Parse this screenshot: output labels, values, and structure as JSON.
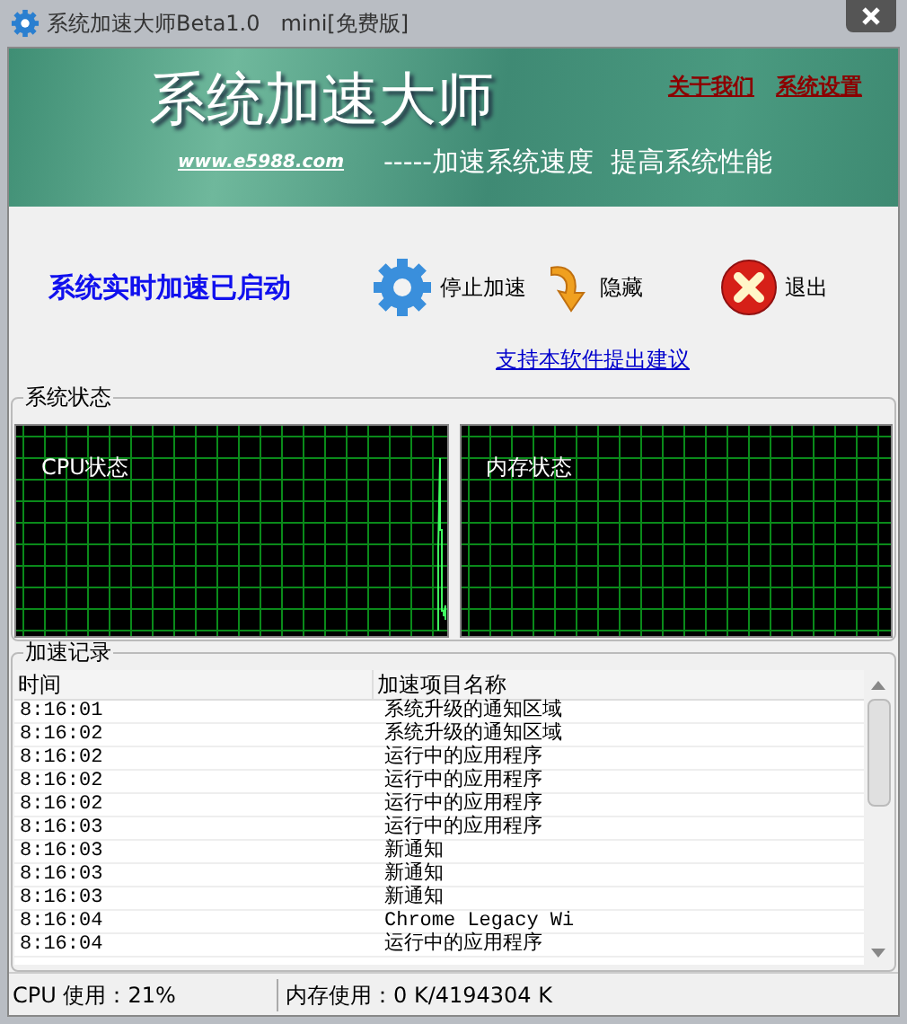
{
  "window": {
    "title": "系统加速大师Beta1.0   mini[免费版]"
  },
  "banner": {
    "title": "系统加速大师",
    "links": [
      "关于我们",
      "系统设置"
    ],
    "site": "www.e5988.com",
    "slogan": "-----加速系统速度  提高系统性能"
  },
  "status_message": "系统实时加速已启动",
  "actions": [
    {
      "kind": "gear",
      "label": "停止加速"
    },
    {
      "kind": "arrow",
      "label": "隐藏"
    },
    {
      "kind": "close",
      "label": "退出"
    }
  ],
  "feedback_link": "支持本软件提出建议",
  "system_status": {
    "title": "系统状态",
    "monitors": [
      {
        "label": "CPU状态",
        "kind": "cpu"
      },
      {
        "label": "内存状态",
        "kind": "memory"
      }
    ]
  },
  "log": {
    "title": "加速记录",
    "columns": [
      "时间",
      "加速项目名称"
    ],
    "rows": [
      {
        "time": "8:16:01",
        "item": "系统升级的通知区域"
      },
      {
        "time": "8:16:02",
        "item": "系统升级的通知区域"
      },
      {
        "time": "8:16:02",
        "item": "运行中的应用程序"
      },
      {
        "time": "8:16:02",
        "item": "运行中的应用程序"
      },
      {
        "time": "8:16:02",
        "item": "运行中的应用程序"
      },
      {
        "time": "8:16:03",
        "item": "运行中的应用程序"
      },
      {
        "time": "8:16:03",
        "item": "新通知"
      },
      {
        "time": "8:16:03",
        "item": "新通知"
      },
      {
        "time": "8:16:03",
        "item": "新通知"
      },
      {
        "time": "8:16:04",
        "item": "Chrome Legacy Wi"
      },
      {
        "time": "8:16:04",
        "item": "运行中的应用程序"
      }
    ]
  },
  "status_bar": {
    "cpu": "CPU 使用：21%",
    "memory": "内存使用：0 K/4194304 K"
  }
}
